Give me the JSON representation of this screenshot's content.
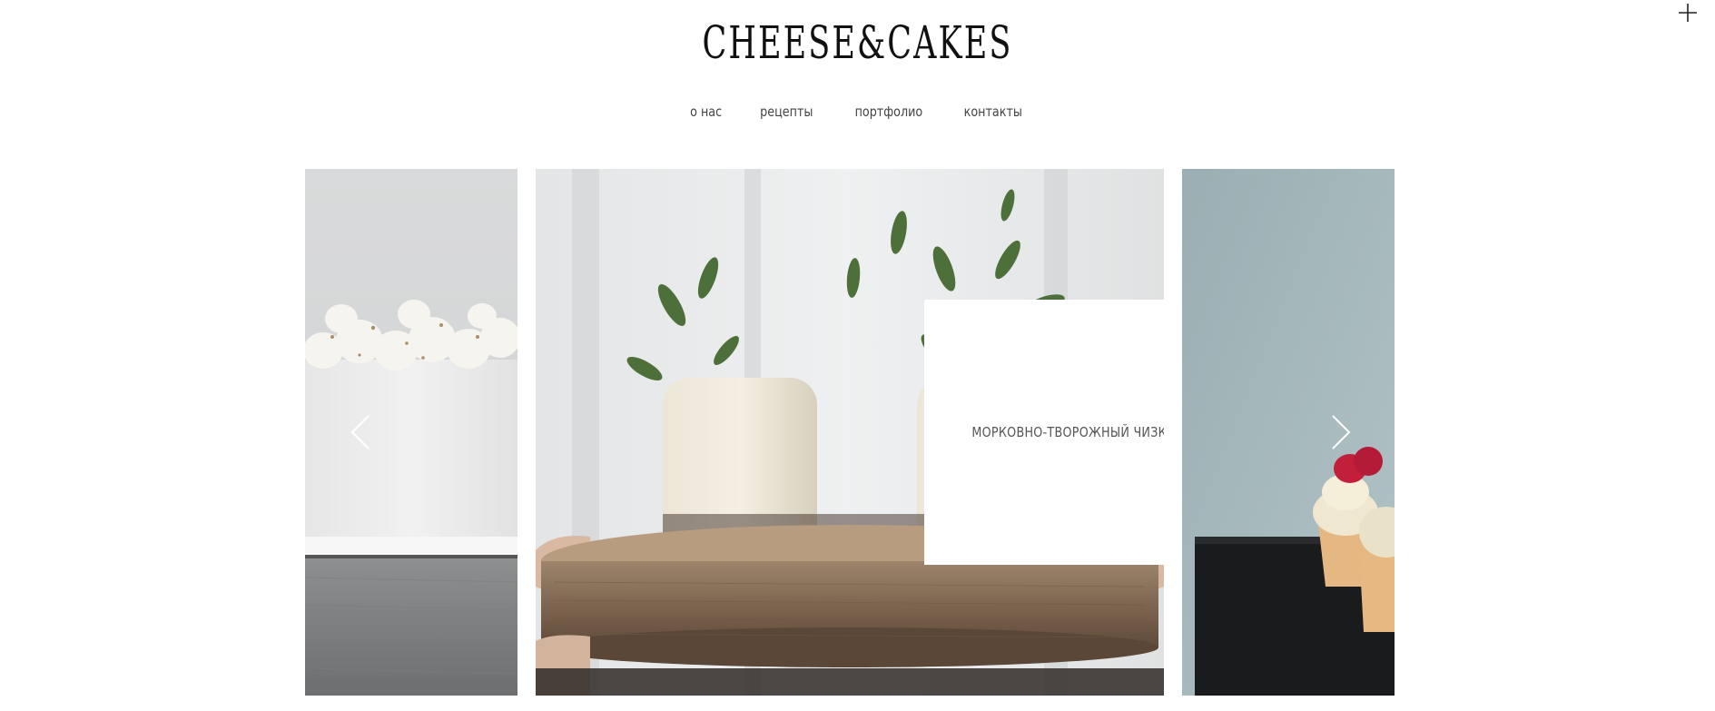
{
  "header": {
    "logo_text": "CHEESE&CAKES"
  },
  "nav": {
    "items": [
      {
        "label": "о нас"
      },
      {
        "label": "рецепты"
      },
      {
        "label": "портфолио"
      },
      {
        "label": "контакты"
      }
    ]
  },
  "slider": {
    "current_caption": "МОРКОВНО-ТВОРОЖНЫЙ ЧИЗКЕЙК"
  },
  "icons": {
    "corner": "plus-icon",
    "prev": "chevron-left-icon",
    "next": "chevron-right-icon"
  }
}
